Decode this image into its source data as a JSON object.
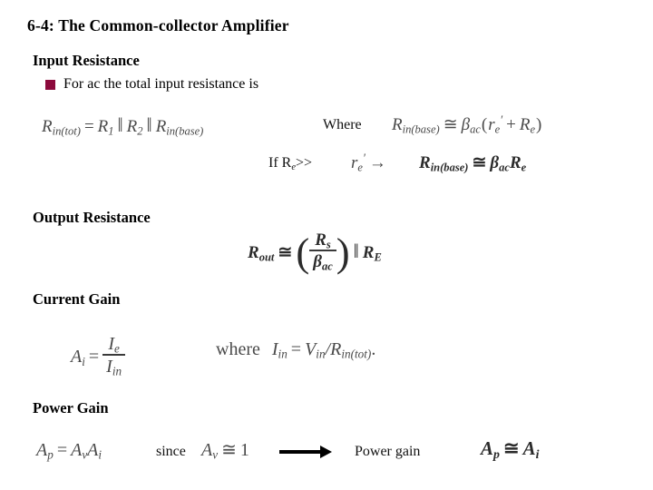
{
  "slide": {
    "title": "6-4: The Common-collector Amplifier",
    "background_color": "#ffffff",
    "bullet_color": "#8c0a3c",
    "math_color": "#4a4a4a"
  },
  "sections": {
    "input_resistance": {
      "heading": "Input Resistance",
      "bullet": "For ac the total input resistance is",
      "bullet_glyph": "filled-square",
      "eq_rin_tot": {
        "lhs_var": "R",
        "lhs_sub": "in(tot)",
        "equals": "=",
        "term1_var": "R",
        "term1_sub": "1",
        "par1": "‖",
        "term2_var": "R",
        "term2_sub": "2",
        "par2": "‖",
        "term3_var": "R",
        "term3_sub": "in(base)"
      },
      "where_label": "Where",
      "eq_rin_base": {
        "lhs_var": "R",
        "lhs_sub": "in(base)",
        "approx": "≅",
        "beta": "β",
        "beta_sub": "ac",
        "open": "(",
        "re_prime_var": "r",
        "re_prime_sub": "e",
        "prime": "′",
        "plus": "+",
        "re_var": "R",
        "re_sub": "e",
        "close": ")"
      },
      "condition_prefix": "If R",
      "condition_prefix_sub": "e",
      "condition_gt": ">>",
      "condition_term_var": "r",
      "condition_term_sub": "e",
      "condition_term_prime": "′",
      "condition_arrow": "→",
      "eq_condition_result": {
        "lhs_var": "R",
        "lhs_sub": "in(base)",
        "approx": "≅",
        "beta": "β",
        "beta_sub": "ac",
        "rhs_var": "R",
        "rhs_sub": "e"
      }
    },
    "output_resistance": {
      "heading": "Output Resistance",
      "eq_rout": {
        "lhs_var": "R",
        "lhs_sub": "out",
        "approx": "≅",
        "paren_open": "(",
        "num_var": "R",
        "num_sub": "s",
        "den_var": "β",
        "den_sub": "ac",
        "paren_close": ")",
        "parallel": "‖",
        "rhs_var": "R",
        "rhs_sub": "E"
      }
    },
    "current_gain": {
      "heading": "Current Gain",
      "eq_ai": {
        "lhs_var": "A",
        "lhs_sub": "i",
        "equals": "=",
        "num_var": "I",
        "num_sub": "e",
        "den_var": "I",
        "den_sub": "in"
      },
      "where_label": "where",
      "eq_iin": {
        "lhs_var": "I",
        "lhs_sub": "in",
        "equals": "=",
        "v_var": "V",
        "v_sub": "in",
        "slash": "/",
        "r_var": "R",
        "r_sub": "in(tot)",
        "period": "."
      }
    },
    "power_gain": {
      "heading": "Power Gain",
      "eq_ap": {
        "lhs_var": "A",
        "lhs_sub": "p",
        "equals": "=",
        "av_var": "A",
        "av_sub": "v",
        "ai_var": "A",
        "ai_sub": "i"
      },
      "since_label": "since",
      "eq_av": {
        "lhs_var": "A",
        "lhs_sub": "v",
        "approx": "≅",
        "value": "1"
      },
      "arrow_glyph": "right-arrow",
      "result_label": "Power gain",
      "eq_ap_result": {
        "lhs_var": "A",
        "lhs_sub": "p",
        "approx": "≅",
        "rhs_var": "A",
        "rhs_sub": "i"
      }
    }
  }
}
